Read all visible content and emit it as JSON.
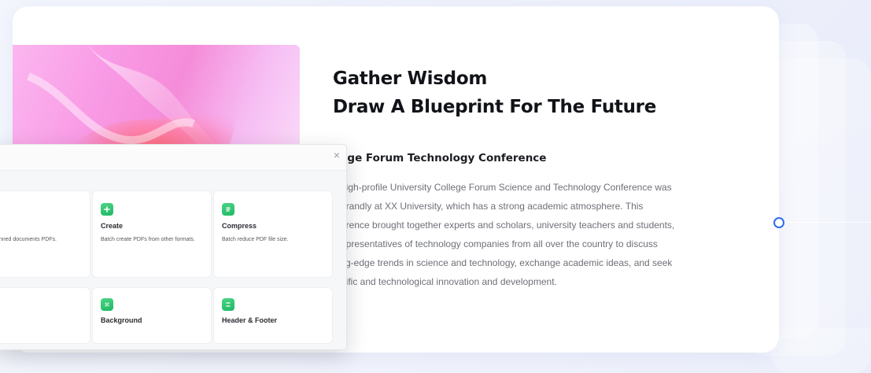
{
  "headline": {
    "line1": "Gather Wisdom",
    "line2": "Draw A Blueprint For The Future"
  },
  "section": {
    "title": "llege Forum Technology Conference",
    "paragraph_lines": [
      "e high-profile University College Forum Science and Technology Conference was",
      "d grandly at XX University, which has a strong academic atmosphere. This",
      "nference brought together experts and scholars, university teachers and students,",
      "l representatives of technology companies from all over the country to discuss",
      "tting-edge trends in science and technology, exchange academic ideas, and seek",
      "entific and technological innovation and development."
    ]
  },
  "dialog": {
    "close_glyph": "×",
    "tools": [
      {
        "name": "",
        "description": "scanned documents\nPDFs."
      },
      {
        "name": "Create",
        "description": "Batch create PDFs from other formats.",
        "icon": "plus-icon"
      },
      {
        "name": "Compress",
        "description": "Batch reduce PDF file size.",
        "icon": "compress-icon"
      },
      {
        "name": "",
        "description": ""
      },
      {
        "name": "Background",
        "description": "",
        "icon": "background-icon"
      },
      {
        "name": "Header & Footer",
        "description": "",
        "icon": "header-footer-icon"
      }
    ]
  },
  "colors": {
    "accent_blue": "#2c6df0",
    "tool_green": "#1fb765",
    "hero_pink": "#f58cd9"
  }
}
